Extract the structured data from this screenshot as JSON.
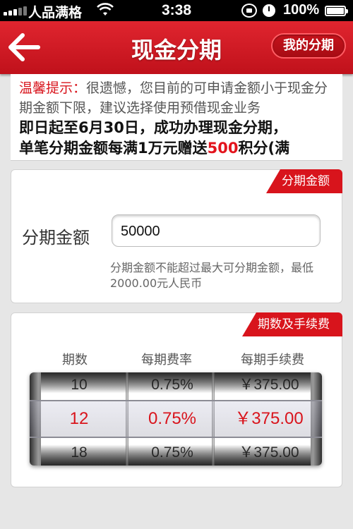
{
  "status_bar": {
    "carrier": "人品满格",
    "time": "3:38",
    "battery": "100%"
  },
  "nav": {
    "title": "现金分期",
    "my_installments_label": "我的分期"
  },
  "notice": {
    "label": "温馨提示：",
    "message": "很遗憾，您目前的可申请金额小于现金分期金额下限，建议选择使用预借现金业务",
    "promo_prefix": "即日起至6月30日，成功办理现金分期，",
    "promo_line2_prefix": "单笔分期金额每满1万元赠送",
    "promo_highlight": "500",
    "promo_line2_suffix": "积分(满"
  },
  "amount_section": {
    "tab_label": "分期金额",
    "field_label": "分期金额",
    "amount_value": "50000",
    "hint": "分期金额不能超过最大可分期金额，最低2000.00元人民币"
  },
  "fee_section": {
    "tab_label": "期数及手续费",
    "headers": {
      "periods": "期数",
      "rate": "每期费率",
      "fee": "每期手续费"
    },
    "rows": [
      {
        "periods": "10",
        "rate": "0.75%",
        "fee": "￥375.00"
      },
      {
        "periods": "12",
        "rate": "0.75%",
        "fee": "￥375.00"
      },
      {
        "periods": "18",
        "rate": "0.75%",
        "fee": "￥375.00"
      }
    ],
    "selected_index": 1
  },
  "colors": {
    "brand_red": "#d8141c",
    "selected_text": "#d9141c"
  },
  "icons": {
    "back": "back-arrow-icon",
    "wifi": "wifi-icon",
    "lock": "rotation-lock-icon",
    "alarm": "alarm-icon",
    "battery": "battery-icon"
  }
}
